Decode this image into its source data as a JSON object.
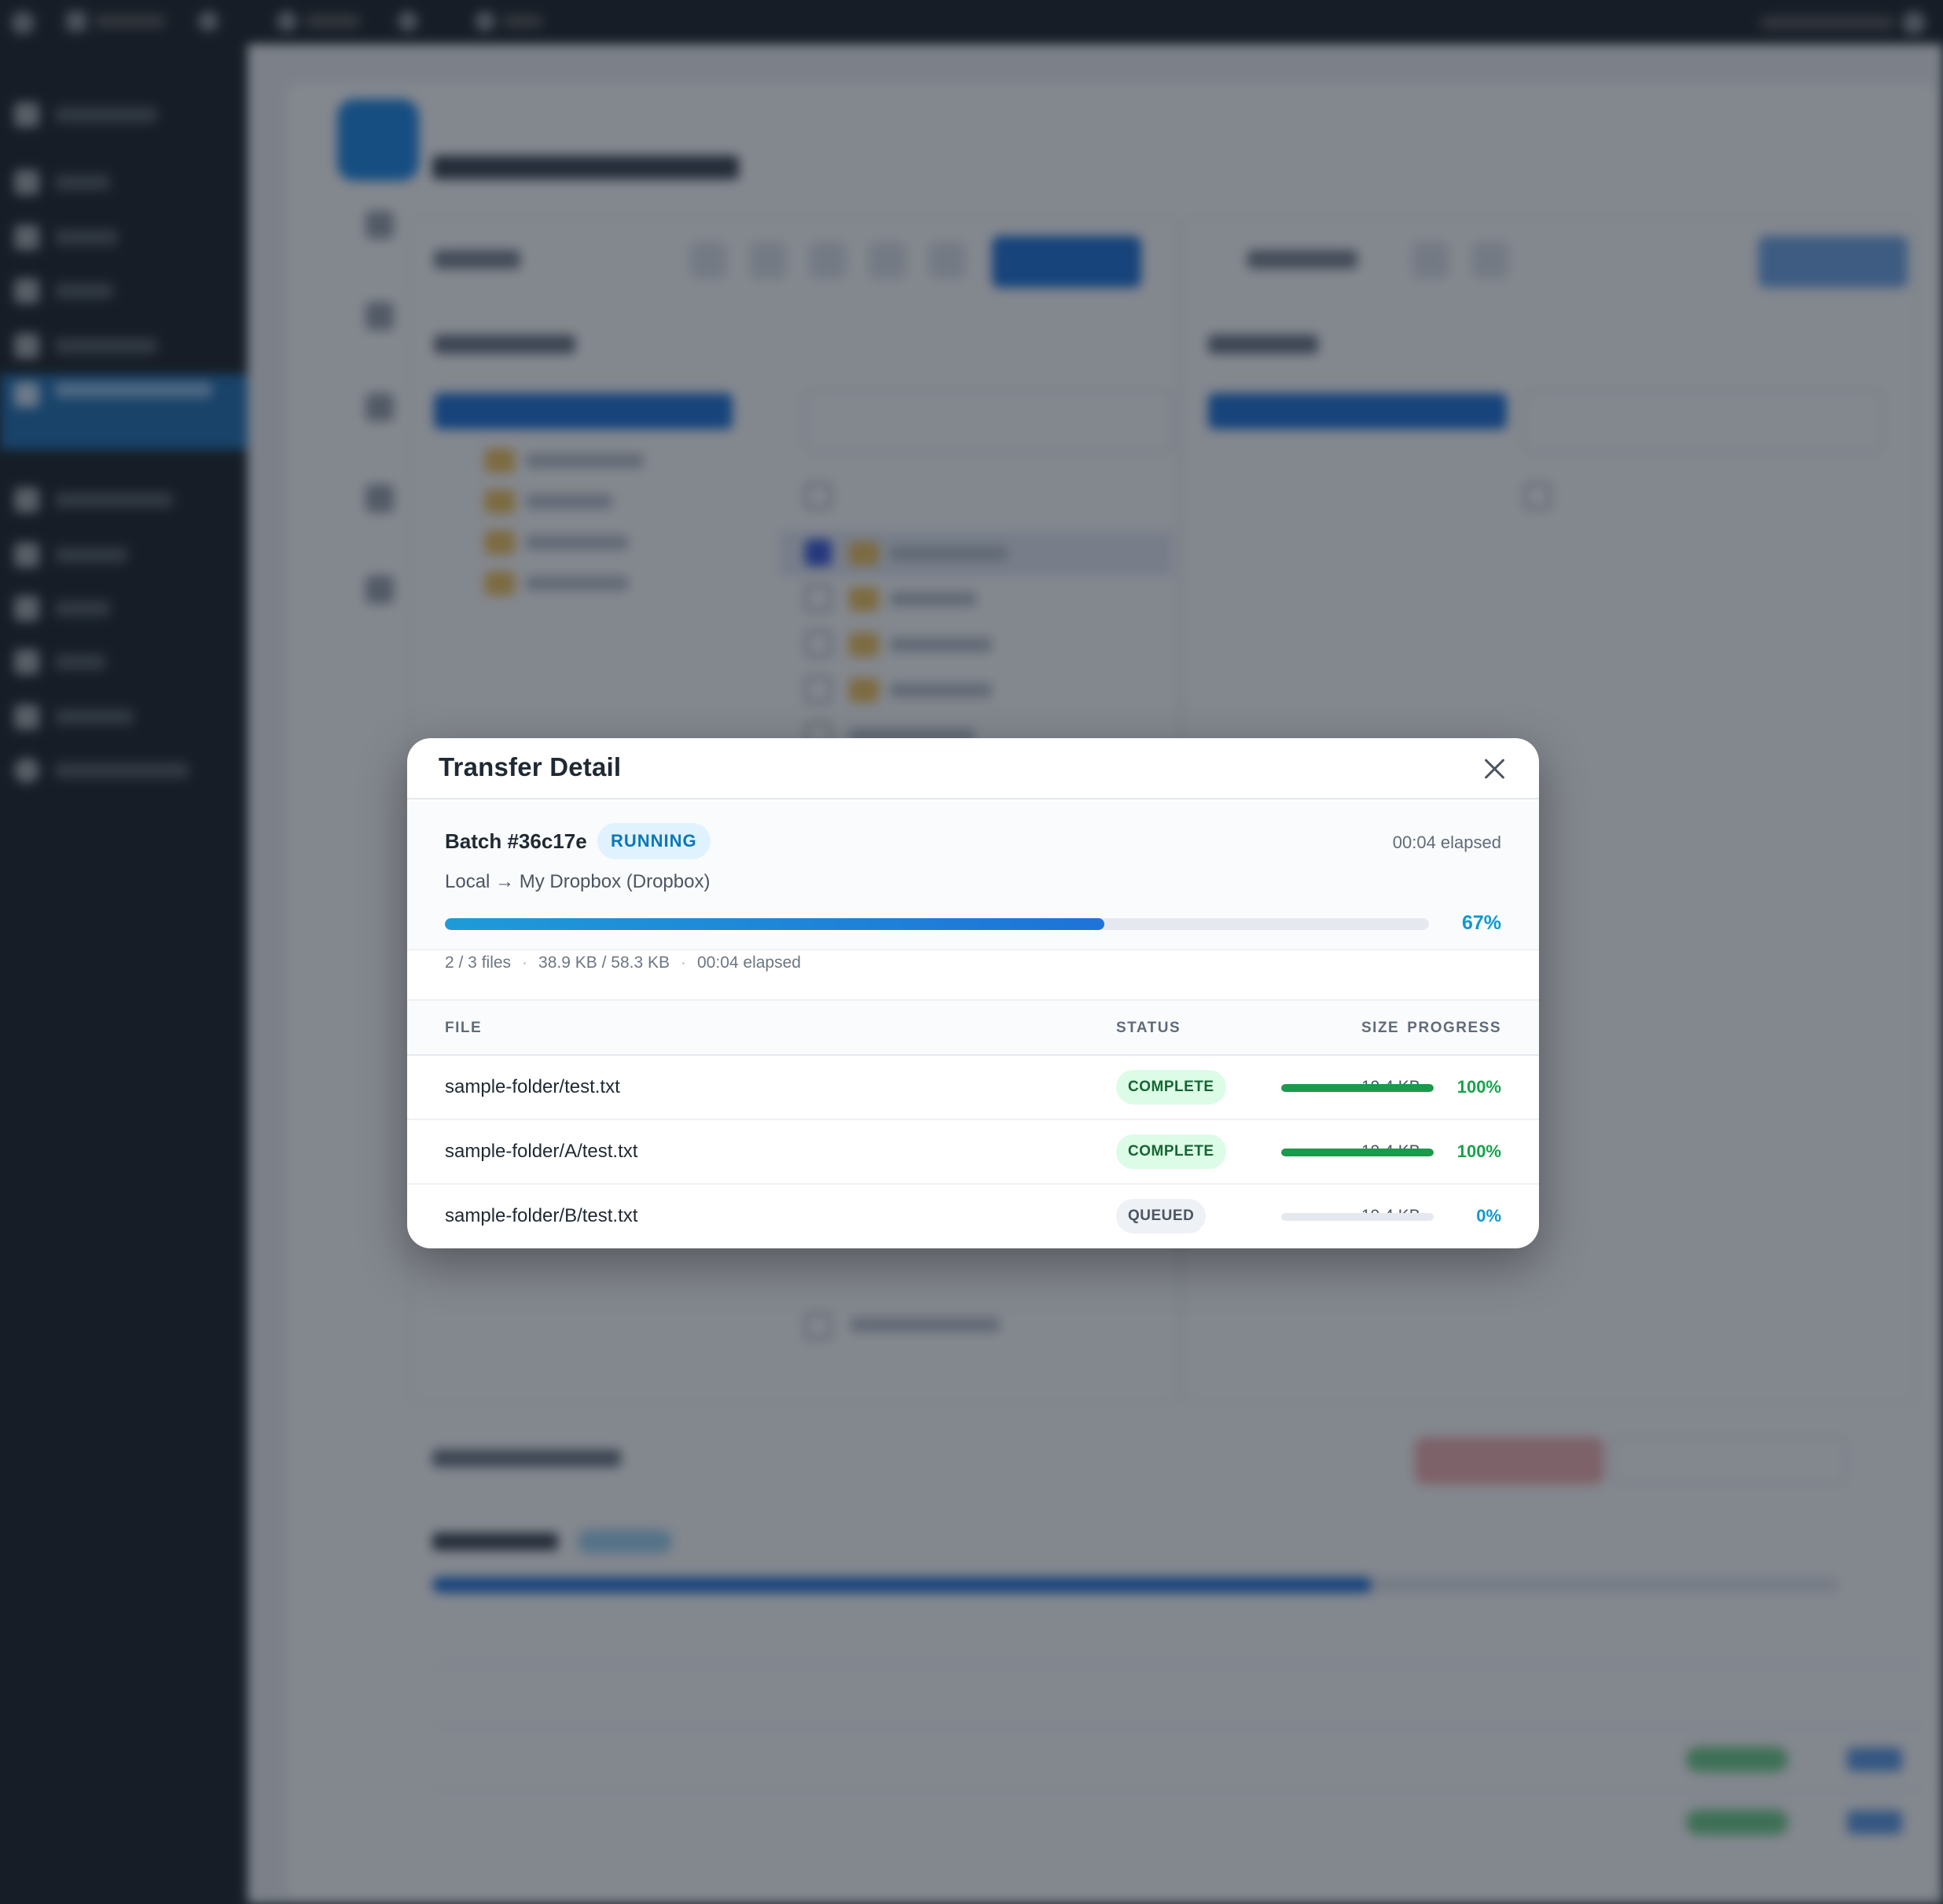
{
  "modal": {
    "title": "Transfer Detail",
    "batch": {
      "id": "Batch #36c17e",
      "state": "RUNNING",
      "elapsed": "00:04 elapsed",
      "route": "Local → My Dropbox (Dropbox)",
      "progress_percent": 67,
      "progress_label": "67%",
      "stats": {
        "files": "2 / 3 files",
        "bytes": "38.9 KB / 58.3 KB",
        "elapsed": "00:04 elapsed",
        "separator": "·"
      }
    },
    "table": {
      "columns": {
        "file": "FILE",
        "size": "SIZE",
        "status": "STATUS",
        "progress": "PROGRESS"
      },
      "rows": [
        {
          "file": "sample-folder/test.txt",
          "size": "19.4 KB",
          "status": "COMPLETE",
          "progress": 100,
          "progress_label": "100%"
        },
        {
          "file": "sample-folder/A/test.txt",
          "size": "19.4 KB",
          "status": "COMPLETE",
          "progress": 100,
          "progress_label": "100%"
        },
        {
          "file": "sample-folder/B/test.txt",
          "size": "19.4 KB",
          "status": "QUEUED",
          "progress": 0,
          "progress_label": "0%"
        }
      ]
    }
  },
  "colors": {
    "accent": "#1e73d8",
    "running_badge": "#0b78b5",
    "complete": "#16a34a",
    "overlay": "rgba(17,24,39,0.52)"
  },
  "icons": {
    "close": "close-icon"
  }
}
